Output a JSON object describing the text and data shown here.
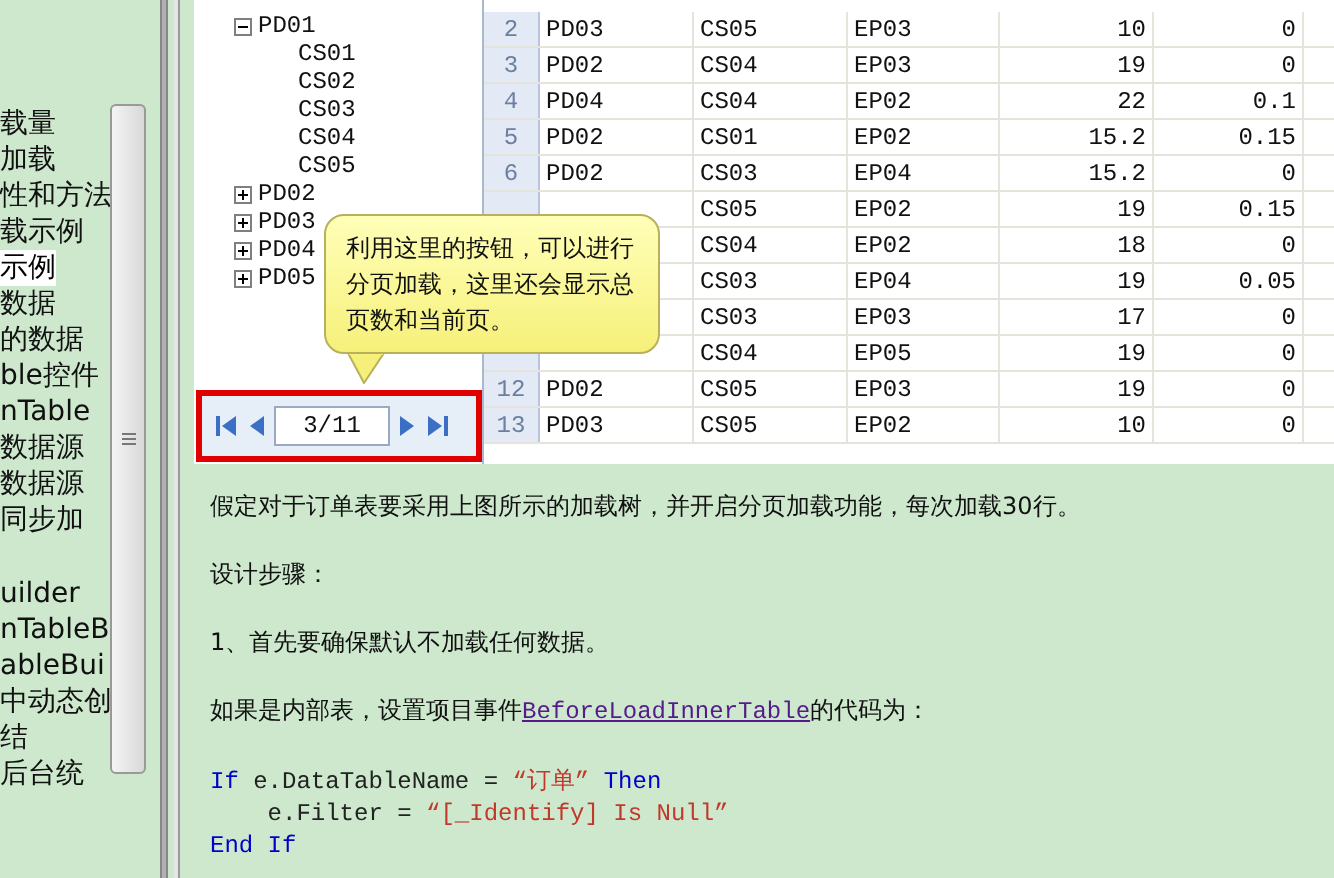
{
  "sidebar": {
    "items": [
      {
        "label": "载量",
        "selected": false
      },
      {
        "label": "加载",
        "selected": false
      },
      {
        "label": "性和方法",
        "selected": false
      },
      {
        "label": "载示例",
        "selected": false
      },
      {
        "label": "示例",
        "selected": true
      },
      {
        "label": "数据",
        "selected": false
      },
      {
        "label": "的数据",
        "selected": false
      },
      {
        "label": "ble控件",
        "selected": false
      },
      {
        "label": "nTable",
        "selected": false
      },
      {
        "label": "数据源",
        "selected": false
      },
      {
        "label": "数据源",
        "selected": false
      },
      {
        "label": "同步加",
        "selected": false
      },
      {
        "label": "uilder",
        "selected": false,
        "gap_before": true
      },
      {
        "label": "nTableB",
        "selected": false
      },
      {
        "label": "ableBui",
        "selected": false
      },
      {
        "label": "中动态创",
        "selected": false
      },
      {
        "label": "结",
        "selected": false
      },
      {
        "label": "后台统",
        "selected": false
      }
    ]
  },
  "tree": [
    {
      "label": "PD01",
      "expanded": true,
      "children": [
        {
          "label": "CS01"
        },
        {
          "label": "CS02"
        },
        {
          "label": "CS03"
        },
        {
          "label": "CS04"
        },
        {
          "label": "CS05"
        }
      ]
    },
    {
      "label": "PD02",
      "expanded": false
    },
    {
      "label": "PD03",
      "expanded": false
    },
    {
      "label": "PD04",
      "expanded": false
    },
    {
      "label": "PD05",
      "expanded": false
    }
  ],
  "pager": {
    "value": "3/11"
  },
  "callout": {
    "text": "利用这里的按钮，可以进行分页加载，这里还会显示总页数和当前页。"
  },
  "grid": {
    "rows": [
      {
        "row_number": "2",
        "cells": [
          "PD03",
          "CS05",
          "EP03",
          "10",
          "0"
        ]
      },
      {
        "row_number": "3",
        "cells": [
          "PD02",
          "CS04",
          "EP03",
          "19",
          "0"
        ]
      },
      {
        "row_number": "4",
        "cells": [
          "PD04",
          "CS04",
          "EP02",
          "22",
          "0.1"
        ]
      },
      {
        "row_number": "5",
        "cells": [
          "PD02",
          "CS01",
          "EP02",
          "15.2",
          "0.15"
        ]
      },
      {
        "row_number": "6",
        "cells": [
          "PD02",
          "CS03",
          "EP04",
          "15.2",
          "0"
        ]
      },
      {
        "row_number": "",
        "cells": [
          "",
          "CS05",
          "EP02",
          "19",
          "0.15"
        ]
      },
      {
        "row_number": "",
        "cells": [
          "",
          "CS04",
          "EP02",
          "18",
          "0"
        ]
      },
      {
        "row_number": "",
        "cells": [
          "",
          "CS03",
          "EP04",
          "19",
          "0.05"
        ]
      },
      {
        "row_number": "",
        "cells": [
          "",
          "CS03",
          "EP03",
          "17",
          "0"
        ]
      },
      {
        "row_number": "",
        "cells": [
          "",
          "CS04",
          "EP05",
          "19",
          "0"
        ]
      },
      {
        "row_number": "12",
        "cells": [
          "PD02",
          "CS05",
          "EP03",
          "19",
          "0"
        ]
      },
      {
        "row_number": "13",
        "cells": [
          "PD03",
          "CS05",
          "EP02",
          "10",
          "0"
        ]
      }
    ]
  },
  "paragraphs": [
    {
      "kind": "text",
      "text": "假定对于订单表要采用上图所示的加载树，并开启分页加载功能，每次加载30行。"
    },
    {
      "kind": "text",
      "text": "设计步骤："
    },
    {
      "kind": "text",
      "text": "1、首先要确保默认不加载任何数据。"
    },
    {
      "kind": "link",
      "before": "如果是内部表，设置项目事件",
      "link": "BeforeLoadInnerTable",
      "after": "的代码为："
    }
  ],
  "code": [
    [
      {
        "kind": "keyword",
        "text": "If"
      },
      {
        "kind": "plain",
        "text": " e.DataTableName = "
      },
      {
        "kind": "string",
        "text": "“订单”"
      },
      {
        "kind": "keyword",
        "text": " Then"
      }
    ],
    [
      {
        "kind": "plain",
        "text": "    e.Filter = "
      },
      {
        "kind": "string",
        "text": "“[_Identify] Is Null”"
      }
    ],
    [
      {
        "kind": "keyword",
        "text": "End If"
      }
    ]
  ]
}
